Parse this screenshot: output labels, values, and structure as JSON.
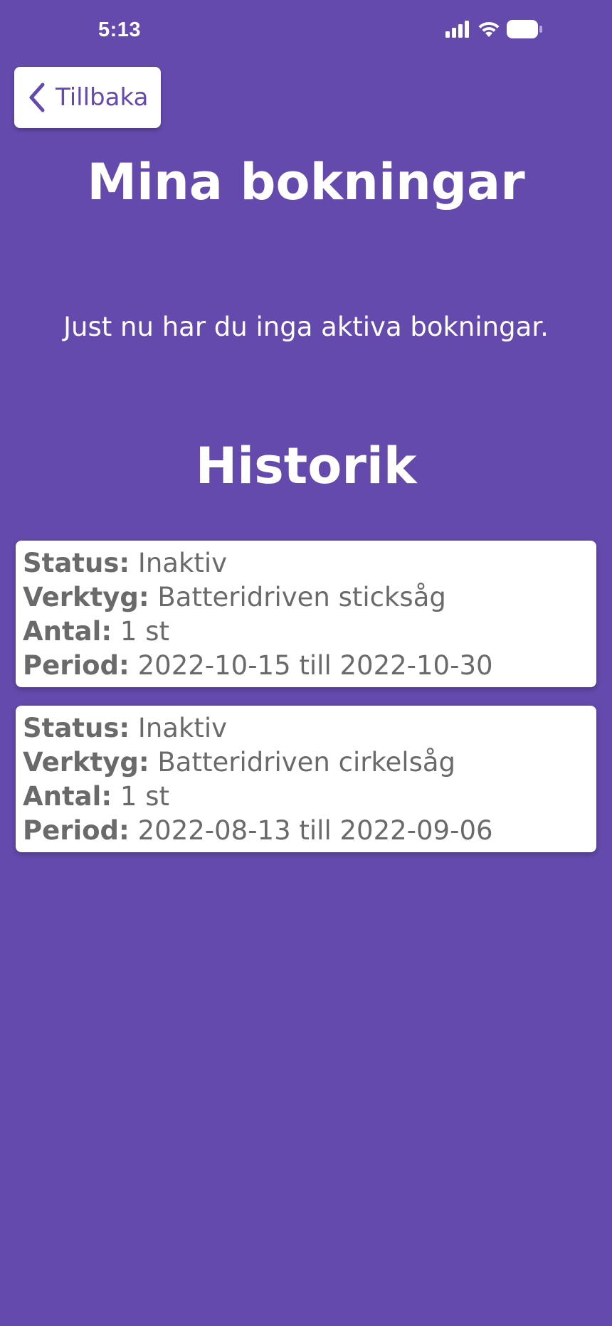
{
  "status_bar": {
    "time": "5:13",
    "icons": [
      "signal-icon",
      "wifi-icon",
      "battery-icon"
    ]
  },
  "header": {
    "back_label": "Tillbaka",
    "title": "Mina bokningar"
  },
  "active": {
    "empty_message": "Just nu har du inga aktiva bokningar."
  },
  "history": {
    "title": "Historik",
    "items": [
      {
        "status_key": "Status:",
        "status_value": "Inaktiv",
        "tool_key": "Verktyg:",
        "tool_value": "Batteridriven sticksåg",
        "count_key": "Antal:",
        "count_value": "1 st",
        "period_key": "Period:",
        "period_value": "2022-10-15 till 2022-10-30"
      },
      {
        "status_key": "Status:",
        "status_value": "Inaktiv",
        "tool_key": "Verktyg:",
        "tool_value": "Batteridriven cirkelsåg",
        "count_key": "Antal:",
        "count_value": "1 st",
        "period_key": "Period:",
        "period_value": "2022-08-13 till 2022-09-06"
      }
    ]
  },
  "colors": {
    "background": "#644aad",
    "card": "#ffffff",
    "card_text": "#6a6a6a",
    "accent": "#644aad"
  }
}
